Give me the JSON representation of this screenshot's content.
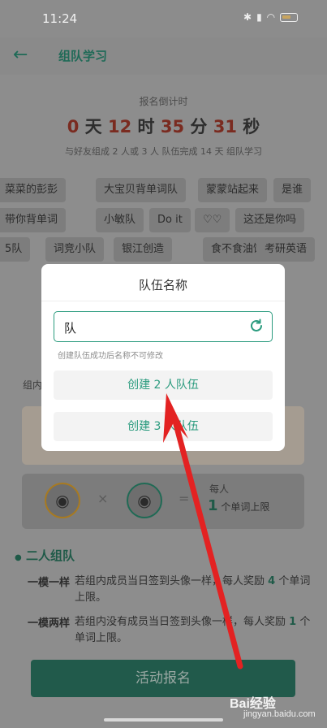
{
  "status_bar": {
    "time": "11:24",
    "battery": "47"
  },
  "header": {
    "title": "组队学习"
  },
  "countdown": {
    "label": "报名倒计时",
    "days": "0",
    "days_unit": "天",
    "hours": "12",
    "hours_unit": "时",
    "minutes": "35",
    "minutes_unit": "分",
    "seconds": "31",
    "seconds_unit": "秒",
    "subtitle": "与好友组成 2 人或 3 人 队伍完成 14 天 组队学习"
  },
  "team_chips": {
    "row1": [
      "菜菜的彭彭",
      "大宝贝背单词队",
      "蒙蒙站起来",
      "是谁"
    ],
    "row2": [
      "带你背单词",
      "小敏队",
      "Do it",
      "♡♡",
      "这还是你吗"
    ],
    "row3": [
      "5队",
      "词竞小队",
      "银江创造",
      "食不食油饼",
      "考研英语"
    ]
  },
  "partial_label": "组内",
  "reward": {
    "per_person": "每人",
    "count": "1",
    "unit": "个单词上限"
  },
  "rules": {
    "title": "二人组队",
    "rule1_label": "一模一样",
    "rule1_text_a": "若组内成员当日签到头像一样，每人奖励 ",
    "rule1_num": "4",
    "rule1_text_b": " 个单词上限。",
    "rule2_label": "一模两样",
    "rule2_text_a": "若组内没有成员当日签到头像一样，每人奖励 ",
    "rule2_num": "1",
    "rule2_text_b": " 个单词上限。"
  },
  "signup_button": "活动报名",
  "modal": {
    "title": "队伍名称",
    "input_value": "队",
    "hint": "创建队伍成功后名称不可修改",
    "create2_label": "创建 2 人队伍",
    "create3_label": "创建 3 人队伍"
  },
  "watermark": {
    "brand": "Bai经验",
    "url": "jingyan.baidu.com"
  },
  "colors": {
    "accent": "#2a9b7e",
    "arrow": "#e32222",
    "overlay": "#8a8a8a"
  }
}
